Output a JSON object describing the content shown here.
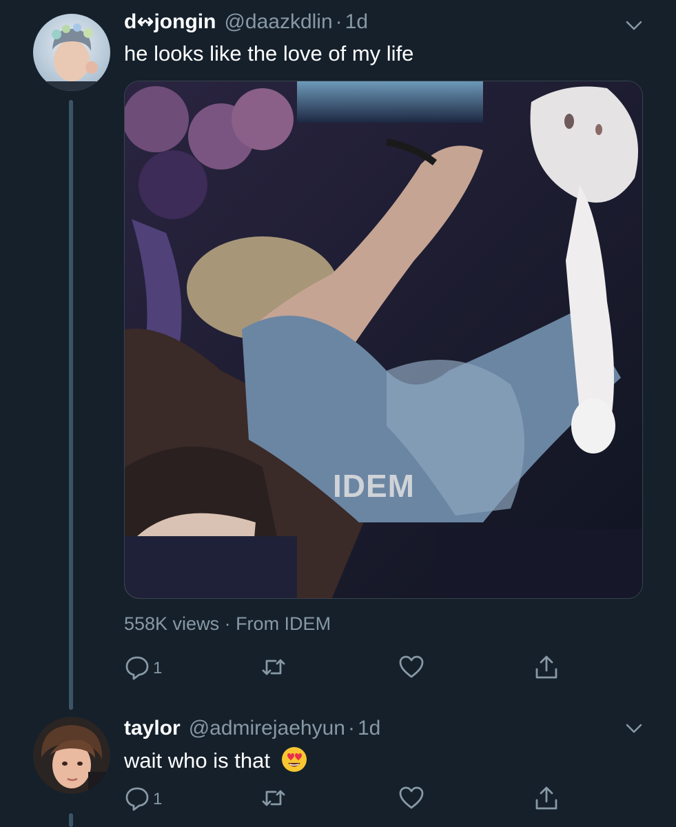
{
  "tweets": [
    {
      "display_name": "d↭jongin",
      "handle": "@daazkdlin",
      "separator": "·",
      "time": "1d",
      "text": "he looks like the love of my life",
      "media": {
        "watermark": "IDEM"
      },
      "meta": "558K views · From IDEM",
      "reply_count": "1"
    },
    {
      "display_name": "taylor",
      "handle": "@admirejaehyun",
      "separator": "·",
      "time": "1d",
      "text": "wait who is that",
      "emoji": "smiling-face-with-heart-eyes",
      "reply_count": "1"
    }
  ],
  "colors": {
    "background": "#15202b",
    "secondary_text": "#8899a6",
    "thread_line": "#3d5466",
    "divider": "#38444d"
  },
  "icons": [
    "reply-icon",
    "retweet-icon",
    "like-icon",
    "share-icon",
    "chevron-down-icon"
  ]
}
